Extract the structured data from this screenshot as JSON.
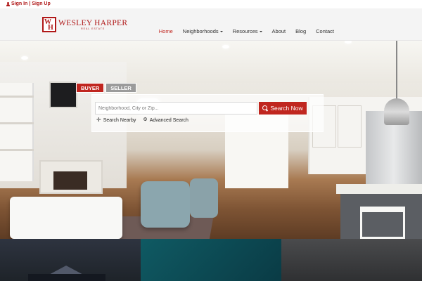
{
  "topbar": {
    "sign_in": "Sign In",
    "separator": "|",
    "sign_up": "Sign Up"
  },
  "logo": {
    "monogram_top": "W",
    "monogram_bottom": "H",
    "name": "WESLEY HARPER",
    "subtitle": "REAL ESTATE"
  },
  "nav": {
    "items": [
      {
        "label": "Home",
        "active": true
      },
      {
        "label": "Neighborhoods",
        "dropdown": true
      },
      {
        "label": "Resources",
        "dropdown": true
      },
      {
        "label": "About"
      },
      {
        "label": "Blog"
      },
      {
        "label": "Contact"
      }
    ]
  },
  "search": {
    "tab_buyer": "BUYER",
    "tab_seller": "SELLER",
    "placeholder": "Neighborhood, City or Zip...",
    "button_label": "Search Now",
    "nearby_label": "Search Nearby",
    "advanced_label": "Advanced Search"
  },
  "colors": {
    "accent": "#c0261f",
    "header_bg": "#f4f4f4",
    "tab_inactive": "#9b9b9b"
  },
  "icons": {
    "user": "user-icon",
    "search": "magnifier-icon",
    "nearby": "crosshair-icon",
    "advanced": "gears-icon"
  }
}
